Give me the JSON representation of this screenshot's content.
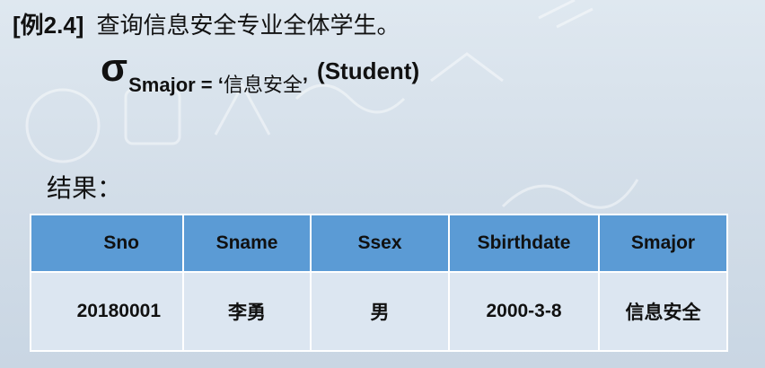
{
  "heading": {
    "tag": "[例2.4]",
    "text": "查询信息安全专业全体学生。"
  },
  "formula": {
    "operator": "σ",
    "condition_attr": "Smajor = ‘",
    "condition_value": "信息安全",
    "condition_close": "’",
    "relation": "(Student)"
  },
  "result_label": "结果：",
  "table": {
    "headers": [
      "Sno",
      "Sname",
      "Ssex",
      "Sbirthdate",
      "Smajor"
    ],
    "rows": [
      [
        "20180001",
        "李勇",
        "男",
        "2000-3-8",
        "信息安全"
      ]
    ]
  },
  "colors": {
    "header_bg": "#5b9bd5",
    "cell_bg": "#dce6f1",
    "page_bg": "#d2dde8"
  }
}
